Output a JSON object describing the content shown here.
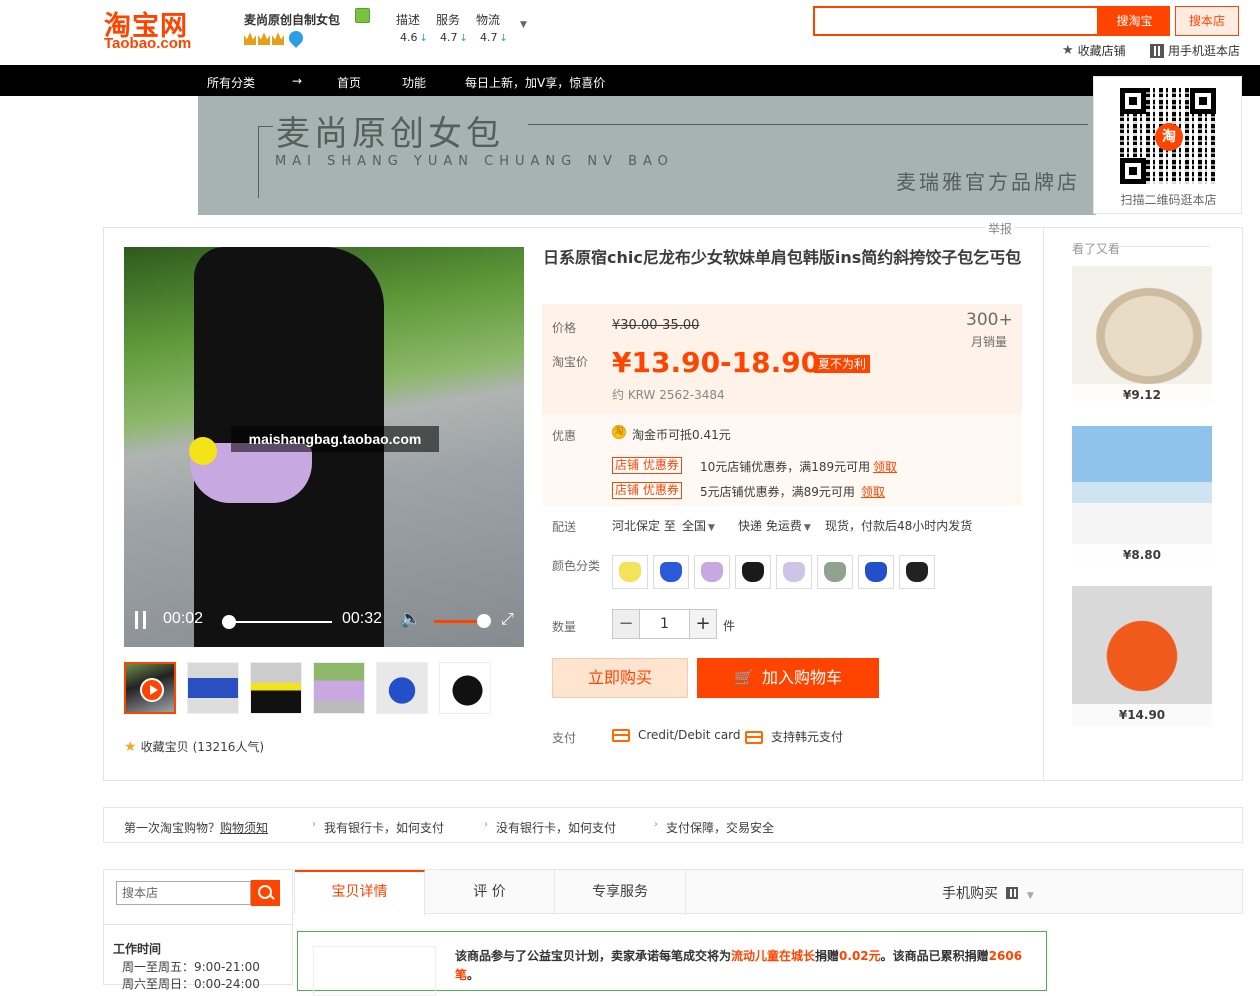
{
  "header": {
    "logo_cn": "淘宝网",
    "logo_en": "Taobao.com",
    "shop_name": "麦尚原创自制女包",
    "scores": [
      {
        "label": "描述",
        "value": "4.6"
      },
      {
        "label": "服务",
        "value": "4.7"
      },
      {
        "label": "物流",
        "value": "4.7"
      }
    ],
    "search_taobao": "搜淘宝",
    "search_shop": "搜本店",
    "fav_shop": "收藏店铺",
    "mobile_shop": "用手机逛本店"
  },
  "nav": {
    "all_categories": "所有分类",
    "arrow": "→",
    "home": "首页",
    "features": "功能",
    "promo": "每日上新，加V享，惊喜价"
  },
  "banner": {
    "title_cn": "麦尚原创女包",
    "title_pinyin": "MAI  SHANG  YUAN CHUANG  NV  BAO",
    "brand": "麦瑞雅官方品牌店"
  },
  "qr": {
    "center_glyph": "淘",
    "caption": "扫描二维码逛本店"
  },
  "report": "举报",
  "video": {
    "watermark": "maishangbag.taobao.com",
    "current_time": "00:02",
    "duration": "00:32",
    "progress": 0.06,
    "volume": 0.75
  },
  "favorite": {
    "label": "收藏宝贝",
    "count": "(13216人气)"
  },
  "product": {
    "title": "日系原宿chic尼龙布少女软妹单肩包韩版ins简约斜挎饺子包乞丐包",
    "price_label": "价格",
    "original_price": "¥30.00-35.00",
    "taobao_price_label": "淘宝价",
    "taobao_price": "¥13.90-18.90",
    "price_tag": "夏不为利",
    "krw": "约 KRW 2562-3484",
    "sales_count": "300+",
    "sales_label": "月销量",
    "promo_label": "优惠",
    "coin_glyph": "淘",
    "coin_text": "淘金币可抵0.41元",
    "coupons": [
      {
        "tag": "店铺 优惠券",
        "text": "10元店铺优惠券，满189元可用",
        "link": "领取"
      },
      {
        "tag": "店铺 优惠券",
        "text": "5元店铺优惠券，满89元可用",
        "link": "领取"
      }
    ],
    "ship_label": "配送",
    "ship_from": "河北保定 至",
    "ship_to": "全国",
    "ship_method": "快递 免运费",
    "ship_note": "现货，付款后48小时内发货",
    "color_label": "颜色分类",
    "colors": [
      "#f4e35a",
      "#2a5ad8",
      "#c8a8e0",
      "#1a1a1a",
      "#d0c4e6",
      "#8fa38e",
      "#2350c8",
      "#222222"
    ],
    "qty_label": "数量",
    "qty_minus": "−",
    "qty_value": "1",
    "qty_plus": "+",
    "unit": "件",
    "buy_now": "立即购买",
    "add_cart": "加入购物车",
    "pay_label": "支付",
    "pay_methods": [
      "Credit/Debit card",
      "支持韩元支付"
    ]
  },
  "sidebar": {
    "title": "看了又看",
    "items": [
      {
        "price": "¥9.12"
      },
      {
        "price": "¥8.80"
      },
      {
        "price": "¥14.90"
      }
    ]
  },
  "tips": {
    "first": "第一次淘宝购物？",
    "first_link": "购物须知",
    "items": [
      "我有银行卡，如何支付",
      "没有银行卡，如何支付",
      "支付保障，交易安全"
    ]
  },
  "left_panel": {
    "search_placeholder": "搜本店",
    "work_title": "工作时间",
    "work_lines": [
      "周一至周五：9:00-21:00",
      "周六至周日：0:00-24:00"
    ]
  },
  "tabs": {
    "items": [
      "宝贝详情",
      "评  价",
      "专享服务"
    ],
    "mobile_buy": "手机购买"
  },
  "charity": {
    "text_a": "该商品参与了公益宝贝计划，卖家承诺每笔成交将为",
    "project": "流动儿童在城长",
    "text_b": "捐赠",
    "amount": "0.02元",
    "text_c": "。该商品已累积捐赠",
    "count": "2606笔",
    "text_d": "。"
  },
  "colors": {
    "accent": "#ff4400",
    "nav_bg": "#000000",
    "banner_bg": "#a6b3b0",
    "price_panel": "#fff2e8"
  }
}
